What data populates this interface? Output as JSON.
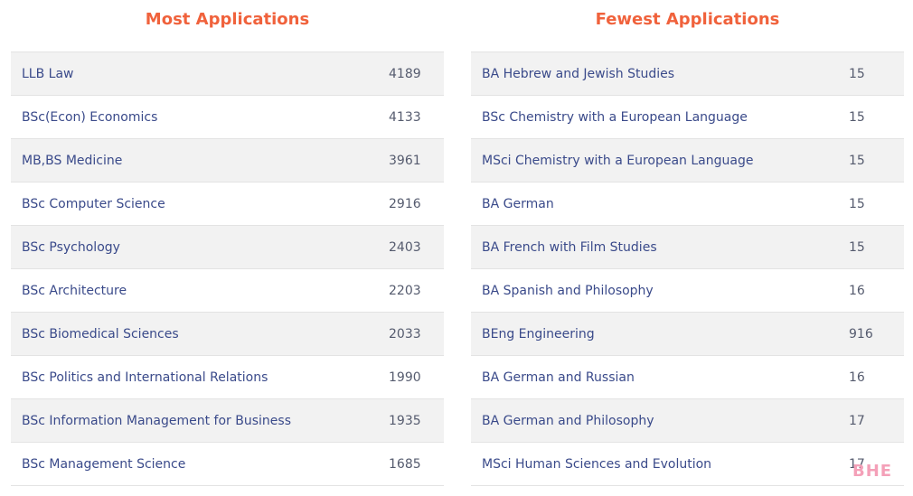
{
  "most": {
    "title": "Most Applications",
    "rows": [
      {
        "course": "LLB Law",
        "count": "4189"
      },
      {
        "course": "BSc(Econ) Economics",
        "count": "4133"
      },
      {
        "course": "MB,BS Medicine",
        "count": "3961"
      },
      {
        "course": "BSc Computer Science",
        "count": "2916"
      },
      {
        "course": "BSc Psychology",
        "count": "2403"
      },
      {
        "course": "BSc Architecture",
        "count": "2203"
      },
      {
        "course": "BSc Biomedical Sciences",
        "count": "2033"
      },
      {
        "course": "BSc Politics and International Relations",
        "count": "1990"
      },
      {
        "course": "BSc Information Management for Business",
        "count": "1935"
      },
      {
        "course": "BSc Management Science",
        "count": "1685"
      }
    ]
  },
  "fewest": {
    "title": "Fewest Applications",
    "rows": [
      {
        "course": "BA Hebrew and Jewish Studies",
        "count": "15"
      },
      {
        "course": "BSc Chemistry with a European Language",
        "count": "15"
      },
      {
        "course": "MSci Chemistry with a European Language",
        "count": "15"
      },
      {
        "course": "BA German",
        "count": "15"
      },
      {
        "course": "BA French with Film Studies",
        "count": "15"
      },
      {
        "course": "BA Spanish and Philosophy",
        "count": "16"
      },
      {
        "course": "BEng Engineering",
        "count": "916"
      },
      {
        "course": "BA German and Russian",
        "count": "16"
      },
      {
        "course": "BA German and Philosophy",
        "count": "17"
      },
      {
        "course": "MSci Human Sciences and Evolution",
        "count": "17"
      }
    ]
  },
  "watermark": "BHE",
  "colors": {
    "title": "#f0623c",
    "course_text": "#3a4a8a",
    "count_text": "#555b6e",
    "stripe": "#f2f2f2",
    "watermark": "#f4a0b8"
  }
}
